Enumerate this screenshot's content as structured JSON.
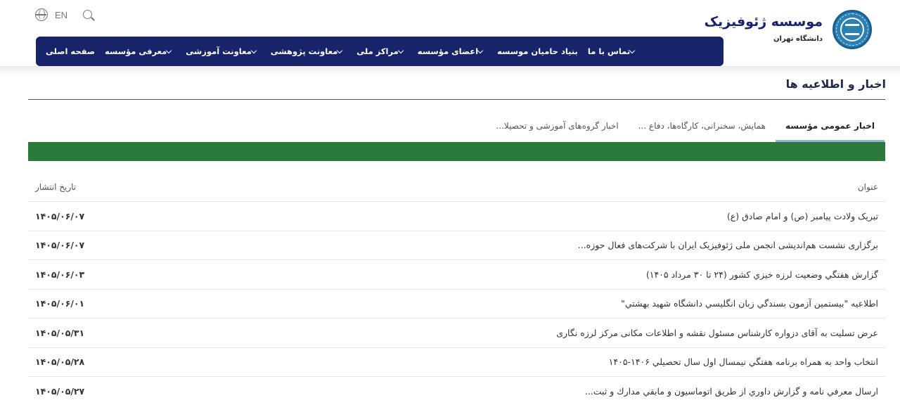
{
  "brand": {
    "title": "موسسه ژئوفیزیک",
    "subtitle": "دانشگاه تهران",
    "logo": "university-of-tehran-seal"
  },
  "lang": {
    "label": "EN",
    "icon": "globe-icon"
  },
  "search": {
    "icon": "search-icon"
  },
  "colors": {
    "nav_bg": "#17246a",
    "green_bar": "#2c7a3b",
    "tab_underline": "#8fb6d8",
    "brand_title": "#16236e"
  },
  "nav": {
    "items": [
      {
        "label": "صفحه اصلی",
        "has_dropdown": false
      },
      {
        "label": "معرفی مؤسسه",
        "has_dropdown": true
      },
      {
        "label": "معاونت آموزشی",
        "has_dropdown": true
      },
      {
        "label": "معاونت پژوهشی",
        "has_dropdown": true
      },
      {
        "label": "مراکز ملی",
        "has_dropdown": true
      },
      {
        "label": "اعضای مؤسسه",
        "has_dropdown": true
      },
      {
        "label": "بنیاد حامیان موسسه",
        "has_dropdown": false
      },
      {
        "label": "تماس با ما",
        "has_dropdown": true
      }
    ]
  },
  "section": {
    "title": "اخبار و اطلاعیه ها",
    "tabs": [
      {
        "label": "اخبار عمومی مؤسسه",
        "active": true
      },
      {
        "label": "همایش، سخنرانی، کارگاه‌ها، دفاع ...",
        "active": false
      },
      {
        "label": "اخبار گروه‌های آموزشی و تحصیلا...",
        "active": false
      }
    ]
  },
  "table": {
    "headers": {
      "title": "عنوان",
      "date": "تاریخ انتشار"
    },
    "rows": [
      {
        "title": "تبریک ولادت پیامبر (ص) و امام صادق (ع)",
        "date": "۱۴۰۵/۰۶/۰۷"
      },
      {
        "title": "برگزاری نشست هم‌اندیشی انجمن ملی ژئوفیزیک ایران با شرکت‌های فعال حوزه...",
        "date": "۱۴۰۵/۰۶/۰۷"
      },
      {
        "title": "گزارش هفتگي وضعيت لرزه خيزي كشور (۲۴ تا ۳۰ مرداد ۱۴۰۵)",
        "date": "۱۴۰۵/۰۶/۰۳"
      },
      {
        "title": "اطلاعيه \"بيستمين آزمون بسندگي زبان انگليسي دانشگاه شهيد بهشتي\"",
        "date": "۱۴۰۵/۰۶/۰۱"
      },
      {
        "title": "عرض تسلیت به آقای دزواره کارشناس مسئول نقشه و اطلاعات مکانی مرکز لرزه نگاری",
        "date": "۱۴۰۵/۰۵/۳۱"
      },
      {
        "title": "انتخاب واحد به همراه برنامه هفتگي نيمسال اول سال تحصيلي ۱۴۰۶-۱۴۰۵",
        "date": "۱۴۰۵/۰۵/۲۸"
      },
      {
        "title": "ارسال معرفي نامه و گزارش داوري از طريق اتوماسيون و مابقي مدارك و ثبت...",
        "date": "۱۴۰۵/۰۵/۲۷"
      }
    ]
  }
}
